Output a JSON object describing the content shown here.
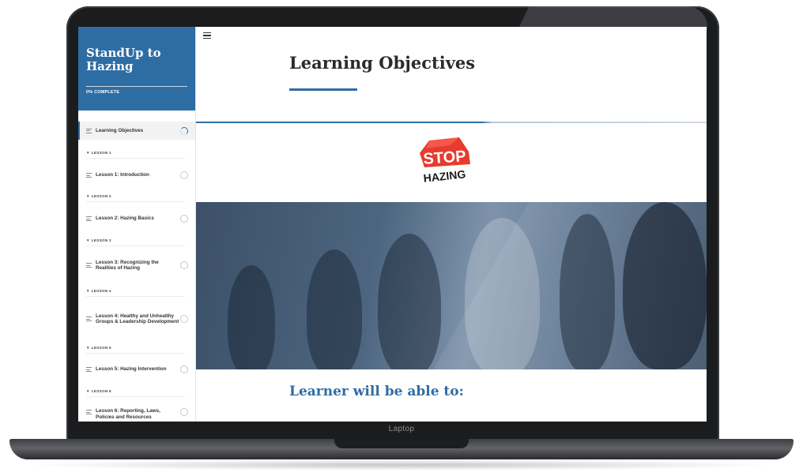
{
  "course": {
    "title": "StandUp to Hazing",
    "progress_text": "0% COMPLETE"
  },
  "sidebar": {
    "items": [
      {
        "type": "lesson",
        "label": "Learning Objectives",
        "status": "in-progress",
        "active": true
      },
      {
        "type": "section",
        "label": "LESSON 1"
      },
      {
        "type": "lesson",
        "label": "Lesson 1: Introduction",
        "status": "not-started"
      },
      {
        "type": "section",
        "label": "LESSON 2"
      },
      {
        "type": "lesson",
        "label": "Lesson 2: Hazing Basics",
        "status": "not-started"
      },
      {
        "type": "section",
        "label": "LESSON 3"
      },
      {
        "type": "lesson",
        "label": "Lesson 3: Recognizing the Realities of Hazing",
        "status": "not-started"
      },
      {
        "type": "section",
        "label": "LESSON 4"
      },
      {
        "type": "lesson",
        "label": "Lesson 4: Healthy and Unhealthy Groups & Leadership Development",
        "status": "not-started"
      },
      {
        "type": "section",
        "label": "LESSON 5"
      },
      {
        "type": "lesson",
        "label": "Lesson 5: Hazing Intervention",
        "status": "not-started"
      },
      {
        "type": "section",
        "label": "LESSON 6"
      },
      {
        "type": "lesson",
        "label": "Lesson 6: Reporting, Laws, Policies and Resources",
        "status": "not-started"
      }
    ]
  },
  "main": {
    "title": "Learning Objectives",
    "logo": {
      "line1": "STOP",
      "line2": "HAZING"
    },
    "subheading": "Learner will be able to:"
  },
  "device": {
    "label": "Laptop"
  },
  "colors": {
    "accent": "#2e6da4",
    "logo_red": "#e63b2e"
  },
  "icons": [
    "menu-icon",
    "lines-icon",
    "progress-circle-icon",
    "empty-circle-icon",
    "triangle-down-icon"
  ]
}
